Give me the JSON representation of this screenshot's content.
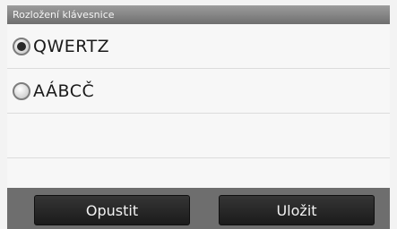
{
  "header": {
    "title": "Rozložení klávesnice"
  },
  "options": [
    {
      "label": "QWERTZ",
      "selected": true
    },
    {
      "label": "AÁBCČ",
      "selected": false
    }
  ],
  "footer": {
    "cancel_label": "Opustit",
    "save_label": "Uložit"
  }
}
